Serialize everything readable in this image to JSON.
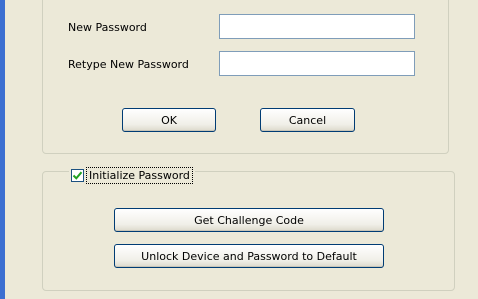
{
  "password_form": {
    "new_password_label": "New Password",
    "new_password_value": "",
    "retype_label": "Retype New Password",
    "retype_value": "",
    "ok_label": "OK",
    "cancel_label": "Cancel"
  },
  "initialize": {
    "checkbox_label": "Initialize Password",
    "checked": true,
    "challenge_button_label": "Get Challenge Code",
    "unlock_button_label": "Unlock Device and Password to Default"
  },
  "colors": {
    "accent": "#3c6fd1",
    "window_bg": "#ece9d8",
    "checkmark": "#21a121",
    "button_border": "#003c74"
  },
  "icons": {
    "checkbox_checkmark": "check-icon"
  }
}
